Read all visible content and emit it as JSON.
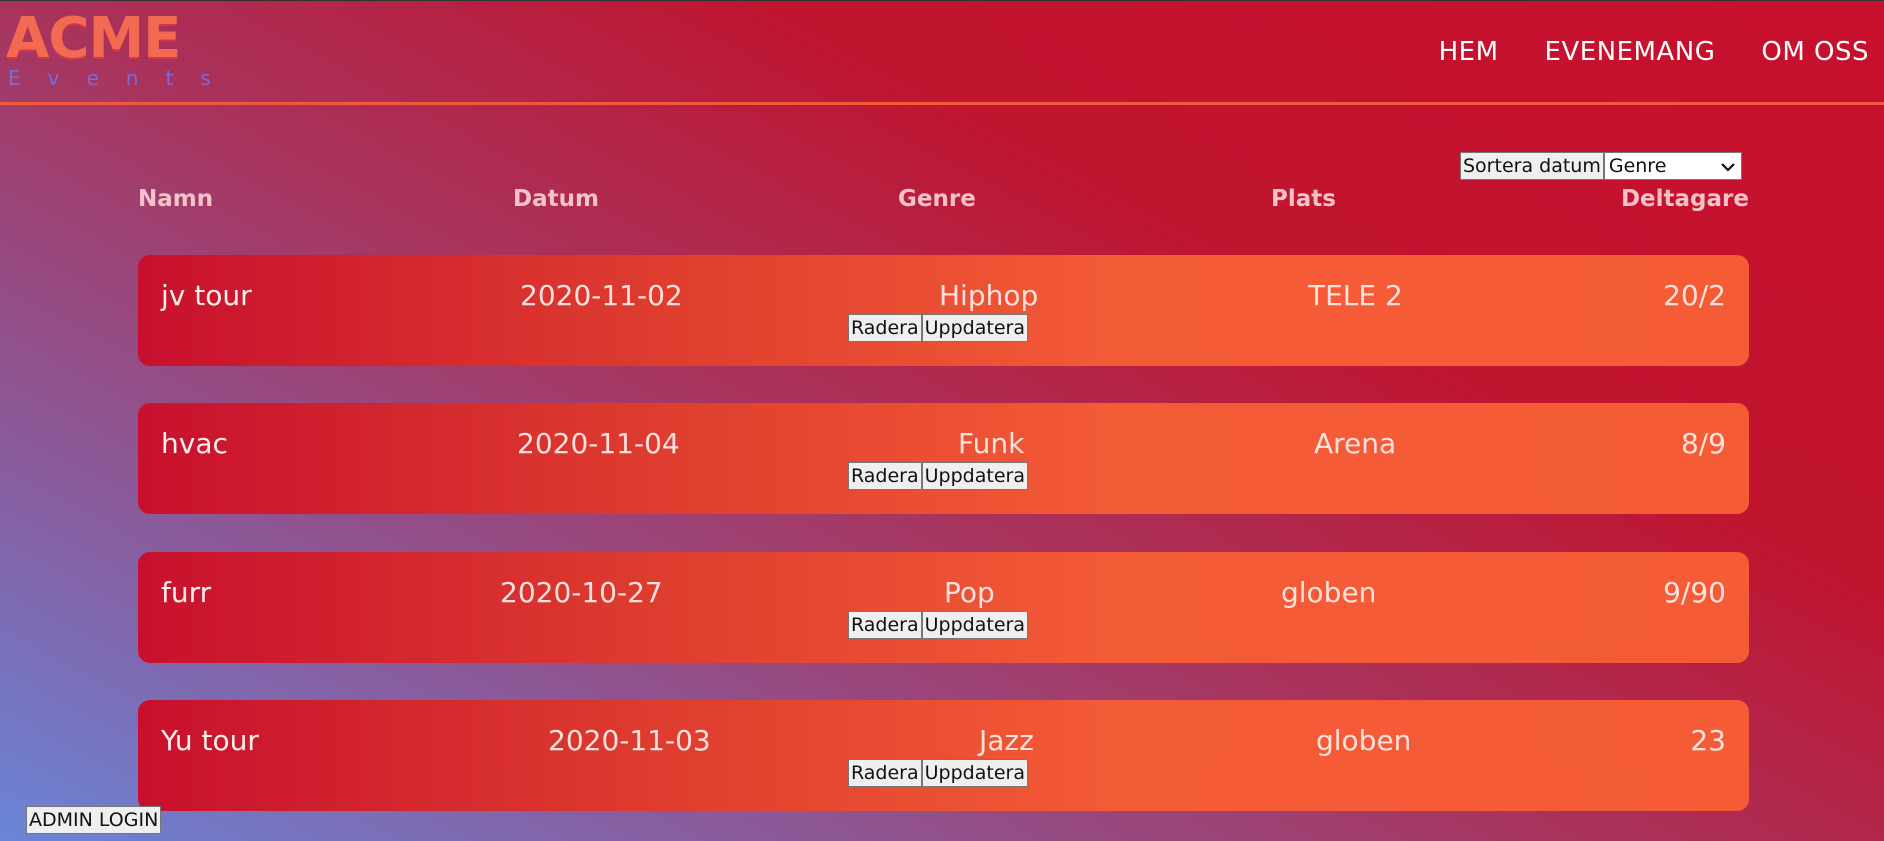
{
  "logo": {
    "title": "ACME",
    "subtitle": "Events"
  },
  "nav": {
    "items": [
      "HEM",
      "EVENEMANG",
      "OM OSS"
    ]
  },
  "controls": {
    "sort_label": "Sortera datum",
    "genre_select_value": "Genre"
  },
  "table": {
    "headers": [
      "Namn",
      "Datum",
      "Genre",
      "Plats",
      "Deltagare"
    ],
    "rows": [
      {
        "name": "jv tour",
        "date": "2020-11-02",
        "genre": "Hiphop",
        "place": "TELE 2",
        "participants": "20/2"
      },
      {
        "name": "hvac",
        "date": "2020-11-04",
        "genre": "Funk",
        "place": "Arena",
        "participants": "8/9"
      },
      {
        "name": "furr",
        "date": "2020-10-27",
        "genre": "Pop",
        "place": "globen",
        "participants": "9/90"
      },
      {
        "name": "Yu tour",
        "date": "2020-11-03",
        "genre": "Jazz",
        "place": "globen",
        "participants": "23"
      }
    ],
    "delete_label": "Radera",
    "update_label": "Uppdatera"
  },
  "admin_login_label": "ADMIN LOGIN",
  "colors": {
    "accent_line": "#f05a3a",
    "row_start": "#c8102e",
    "row_end": "#f55c36"
  }
}
